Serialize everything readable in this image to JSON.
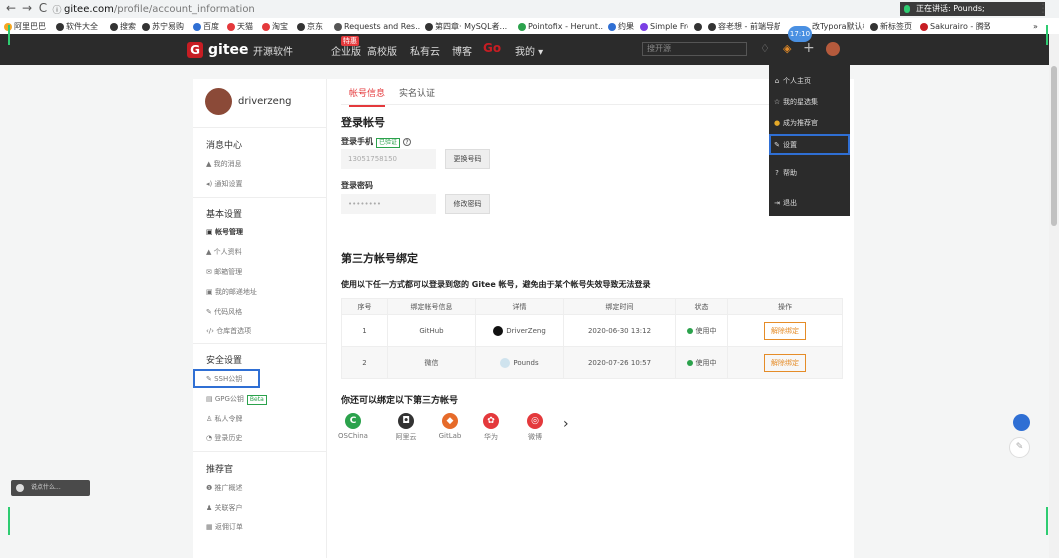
{
  "browser": {
    "back": "←",
    "forward": "→",
    "reload": "C",
    "secure_icon": "info-icon",
    "url_host": "gitee.com",
    "url_path": "/profile/account_information",
    "bookmarks": [
      "阿里巴巴",
      "软件大全",
      "搜索",
      "苏宁易购",
      "百度",
      "天猫",
      "淘宝",
      "京东",
      "Requests and Res...",
      "第四章· MySQL者...",
      "Pointofix - Herunt...",
      "约果",
      "Simple Free Imag...",
      "",
      "容老想 - 前端导航...",
      "改Typora默认样...",
      "新标签页",
      "Sakurairo - 腾致博..."
    ],
    "more": "»",
    "speaking": "正在讲话: Pounds;"
  },
  "nav": {
    "logo": "gitee",
    "items": [
      "开源软件",
      "企业版",
      "高校版",
      "私有云",
      "博客"
    ],
    "hot_badge": "特惠",
    "go": "Go",
    "mine": "我的 ▾",
    "search_placeholder": "搜开源",
    "time": "17:10"
  },
  "dropdown": {
    "items": [
      "个人主页",
      "我的星选集",
      "成为推荐官",
      "设置",
      "帮助",
      "退出"
    ]
  },
  "sidebar": {
    "username": "driverzeng",
    "msg_head": "消息中心",
    "msg_items": [
      "我的消息",
      "通知设置"
    ],
    "basic_head": "基本设置",
    "basic_items": [
      "帐号管理",
      "个人资料",
      "邮箱管理",
      "我的邮递地址",
      "代码风格",
      "仓库首选项"
    ],
    "sec_head": "安全设置",
    "sec_items": [
      "SSH公钥",
      "GPG公钥",
      "私人令牌",
      "登录历史"
    ],
    "beta": "Beta",
    "rec_head": "推荐官",
    "rec_items": [
      "推广概述",
      "关联客户",
      "返佣订单"
    ]
  },
  "main": {
    "tabs": [
      "帐号信息",
      "实名认证"
    ],
    "login_title": "登录帐号",
    "phone_label": "登录手机",
    "verified": "已验证",
    "phone_value": "13051758150",
    "change_phone": "更换号码",
    "pwd_label": "登录密码",
    "pwd_value": "••••••••",
    "change_pwd": "修改密码",
    "third_title": "第三方帐号绑定",
    "third_desc": "使用以下任一方式都可以登录到您的 Gitee 帐号，避免由于某个帐号失效导致无法登录",
    "table_head": [
      "序号",
      "绑定帐号信息",
      "详情",
      "绑定时间",
      "状态",
      "操作"
    ],
    "rows": [
      [
        "1",
        "GitHub",
        "DriverZeng",
        "2020-06-30 13:12",
        "使用中",
        "解除绑定"
      ],
      [
        "2",
        "微信",
        "Pounds",
        "2020-07-26 10:57",
        "使用中",
        "解除绑定"
      ]
    ],
    "also_bind": "你还可以绑定以下第三方帐号",
    "providers": [
      "OSChina",
      "阿里云",
      "GitLab",
      "华为",
      "微博"
    ],
    "next": "›"
  },
  "chat": {
    "label": "说点什么..."
  },
  "colors": {
    "brand": "#c71d23",
    "accent": "#2f6fd4",
    "ok": "#2ba24c",
    "warn": "#e58c28"
  }
}
